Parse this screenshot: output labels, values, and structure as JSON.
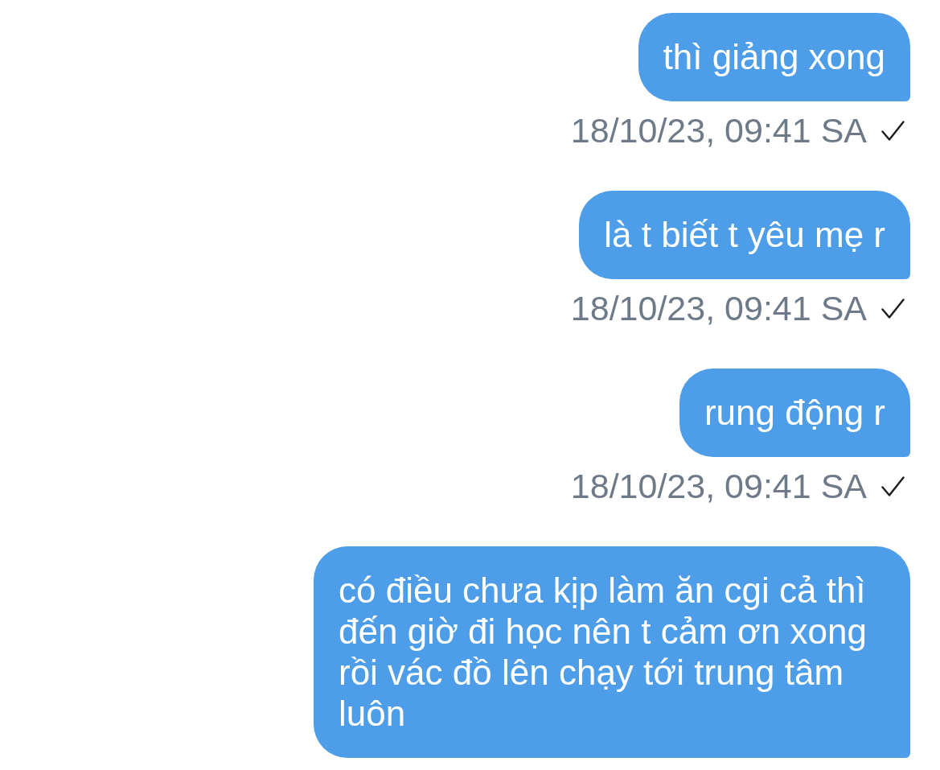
{
  "messages": [
    {
      "text": "thì giảng xong",
      "timestamp": "18/10/23, 09:41 SA",
      "sent": true
    },
    {
      "text": "là t biết t yêu mẹ r",
      "timestamp": "18/10/23, 09:41 SA",
      "sent": true
    },
    {
      "text": "rung động r",
      "timestamp": "18/10/23, 09:41 SA",
      "sent": true
    },
    {
      "text": "có điều chưa kịp làm ăn cgi cả thì đến giờ đi học nên t cảm ơn xong rồi vác đồ lên chạy tới trung tâm luôn"
    }
  ]
}
